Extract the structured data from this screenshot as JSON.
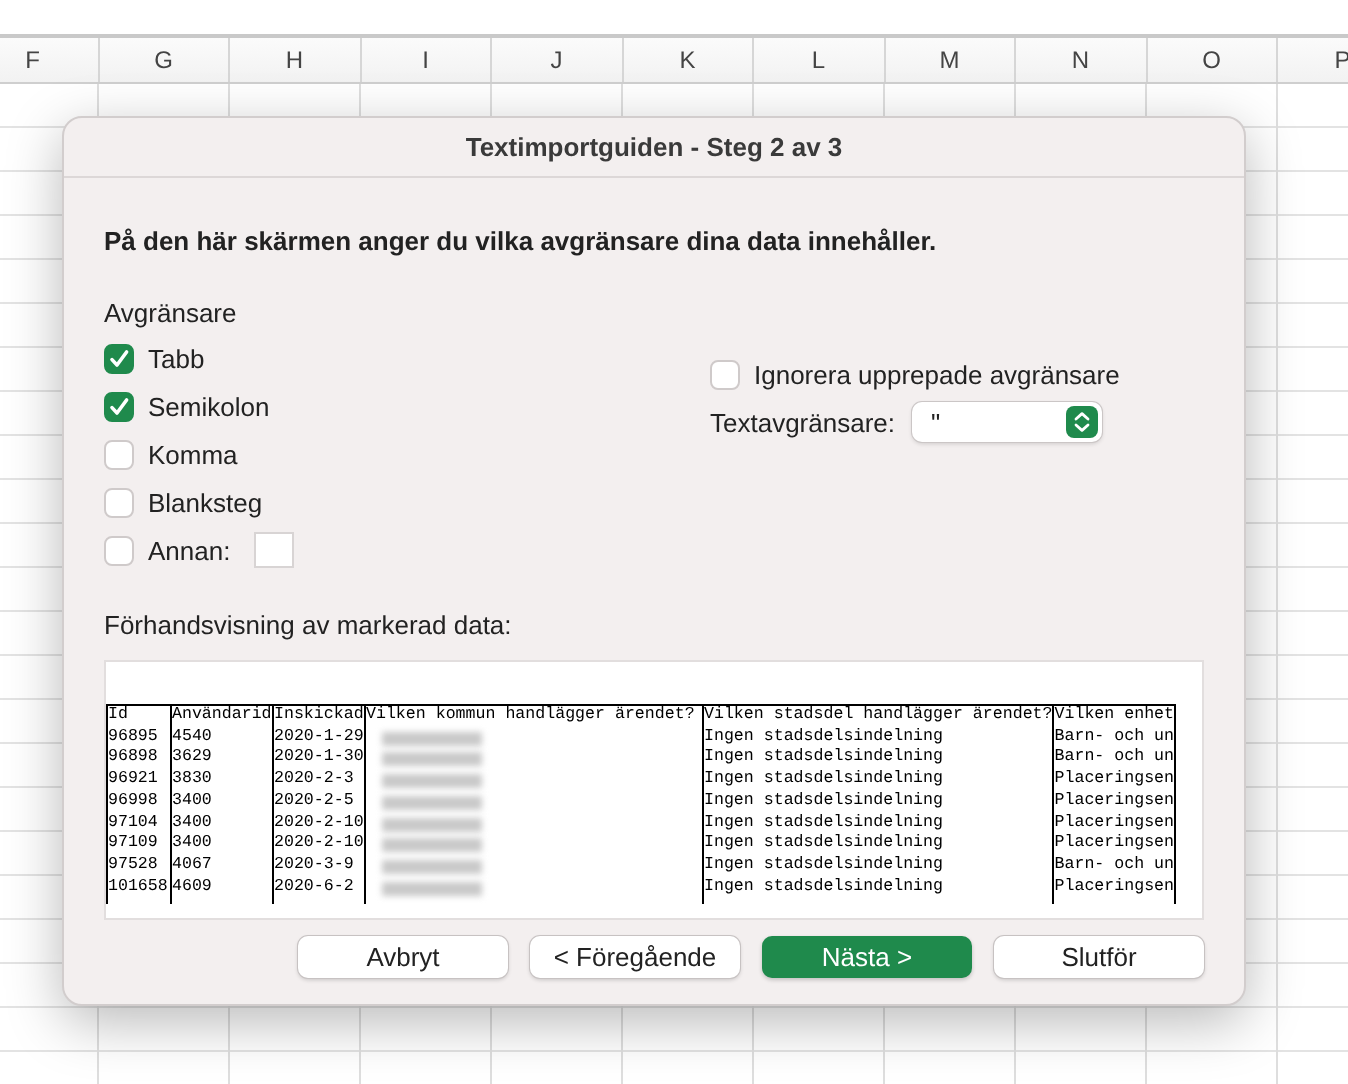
{
  "spreadsheet": {
    "columns": [
      "F",
      "G",
      "H",
      "I",
      "J",
      "K",
      "L",
      "M",
      "N",
      "O",
      "P"
    ]
  },
  "dialog": {
    "title": "Textimportguiden - Steg 2 av 3",
    "instruction": "På den här skärmen anger du vilka avgränsare dina data innehåller.",
    "delimiters_label": "Avgränsare",
    "delimiters": [
      {
        "label": "Tabb",
        "checked": true
      },
      {
        "label": "Semikolon",
        "checked": true
      },
      {
        "label": "Komma",
        "checked": false
      },
      {
        "label": "Blanksteg",
        "checked": false
      },
      {
        "label": "Annan:",
        "checked": false,
        "kind": "other"
      }
    ],
    "ignore_repeated": {
      "label": "Ignorera upprepade avgränsare",
      "checked": false
    },
    "text_qualifier": {
      "label": "Textavgränsare:",
      "value": "\""
    },
    "preview": {
      "label": "Förhandsvisning av markerad data:",
      "columns": [
        "Id",
        "Användarid",
        "Inskickad",
        "Vilken kommun handlägger ärendet?",
        "Vilken stadsdel handlägger ärendet?",
        "Vilken enhet"
      ],
      "rows": [
        [
          "96895",
          "4540",
          "2020-1-29",
          null,
          "Ingen stadsdelsindelning",
          "Barn- och un"
        ],
        [
          "96898",
          "3629",
          "2020-1-30",
          null,
          "Ingen stadsdelsindelning",
          "Barn- och un"
        ],
        [
          "96921",
          "3830",
          "2020-2-3",
          null,
          "Ingen stadsdelsindelning",
          "Placeringsen"
        ],
        [
          "96998",
          "3400",
          "2020-2-5",
          null,
          "Ingen stadsdelsindelning",
          "Placeringsen"
        ],
        [
          "97104",
          "3400",
          "2020-2-10",
          null,
          "Ingen stadsdelsindelning",
          "Placeringsen"
        ],
        [
          "97109",
          "3400",
          "2020-2-10",
          null,
          "Ingen stadsdelsindelning",
          "Placeringsen"
        ],
        [
          "97528",
          "4067",
          "2020-3-9",
          null,
          "Ingen stadsdelsindelning",
          "Barn- och un"
        ],
        [
          "101658",
          "4609",
          "2020-6-2",
          null,
          "Ingen stadsdelsindelning",
          "Placeringsen"
        ]
      ]
    },
    "buttons": [
      {
        "label": "Avbryt",
        "default": false
      },
      {
        "label": "< Föregående",
        "default": false
      },
      {
        "label": "Nästa >",
        "default": true
      },
      {
        "label": "Slutför",
        "default": false
      }
    ]
  }
}
